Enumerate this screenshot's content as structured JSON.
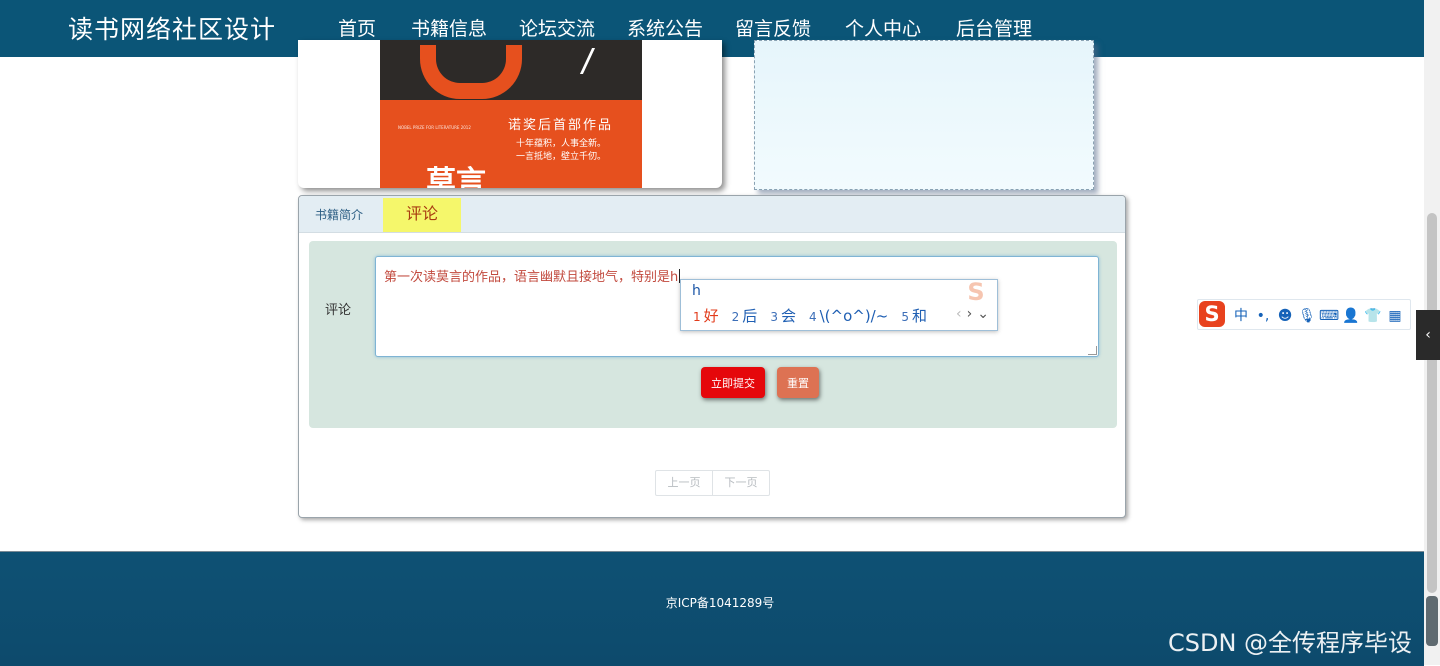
{
  "header": {
    "site_title": "读书网络社区设计",
    "nav": [
      {
        "label": "首页"
      },
      {
        "label": "书籍信息"
      },
      {
        "label": "论坛交流"
      },
      {
        "label": "系统公告"
      },
      {
        "label": "留言反馈"
      },
      {
        "label": "个人中心"
      },
      {
        "label": "后台管理"
      }
    ],
    "active_nav": "书籍信息"
  },
  "book_cover": {
    "line1": "诺奖后首部作品",
    "line2": "十年蕴积，人事全新。",
    "line3": "一言抵地，壁立千仞。",
    "small_en": "NOBEL PRIZE FOR LITERATURE 2012",
    "author": "莫言"
  },
  "tabs": {
    "intro": "书籍简介",
    "comment": "评论",
    "active": "评论"
  },
  "comment_form": {
    "label": "评论",
    "value": "第一次读莫言的作品，语言幽默且接地气，特别是h",
    "submit_label": "立即提交",
    "reset_label": "重置"
  },
  "pager": {
    "prev": "上一页",
    "next": "下一页"
  },
  "ime": {
    "input": "h",
    "candidates": [
      {
        "num": "1",
        "text": "好"
      },
      {
        "num": "2",
        "text": "后"
      },
      {
        "num": "3",
        "text": "会"
      },
      {
        "num": "4",
        "text": "\\(^o^)/~"
      },
      {
        "num": "5",
        "text": "和"
      }
    ],
    "toolbar": {
      "logo": "S",
      "lang": "中",
      "punct": "•,"
    }
  },
  "footer": {
    "icp": "京ICP备1041289号"
  },
  "watermark": "CSDN @全传程序毕设",
  "colors": {
    "header_bg": "#0b5577",
    "footer_bg": "#0e5174",
    "comment_tab_bg": "#f5f76b",
    "submit_bg": "#e5070b",
    "reset_bg": "#dd7253",
    "comment_area_bg": "#d6e6df"
  }
}
